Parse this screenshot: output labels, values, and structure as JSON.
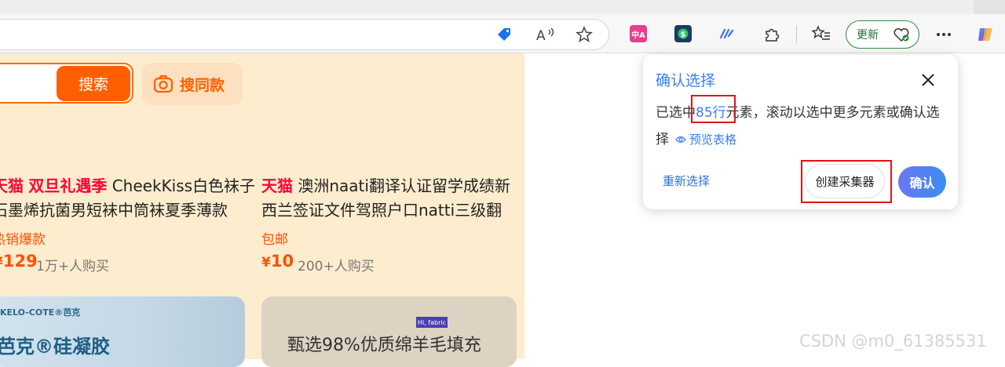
{
  "toolbar": {
    "update_label": "更新",
    "translate_icon_text": "中A"
  },
  "search": {
    "search_label": "搜索",
    "same_style_label": "搜同款"
  },
  "products": [
    {
      "tmall": "天猫",
      "promo": "双旦礼遇季",
      "line1": "CheekKiss白色袜子",
      "line2": "石墨烯抗菌男短袜中筒袜夏季薄款",
      "tag": "热销爆款",
      "currency": "¥",
      "price": "129",
      "buyers": "1万+人购买"
    },
    {
      "tmall": "天猫",
      "line1": "澳洲naati翻译认证留学成绩新",
      "line2": "西兰签证文件驾照户口natti三级翻",
      "tag": "包邮",
      "currency": "¥",
      "price": "10",
      "buyers": "200+人购买"
    }
  ],
  "banners": [
    {
      "brand": "KELO-COTE®芭克",
      "headline": "芭克®硅凝胶"
    },
    {
      "badge": "Hi, fabric",
      "headline": "甄选98%优质绵羊毛填充"
    }
  ],
  "popup": {
    "title": "确认选择",
    "msg_prefix": "已选中",
    "count": "85行",
    "msg_suffix": "元素，滚动以选中更多元素或确认选择",
    "preview_link": "预览表格",
    "reselect_label": "重新选择",
    "create_label": "创建采集器",
    "confirm_label": "确认"
  },
  "watermark": "CSDN @m0_61385531",
  "colors": {
    "accent_orange": "#ff5f00",
    "tmall_red": "#ff0036",
    "link_blue": "#3b7ff0",
    "annotation_red": "#e01515",
    "page_bg": "#fdedce"
  }
}
